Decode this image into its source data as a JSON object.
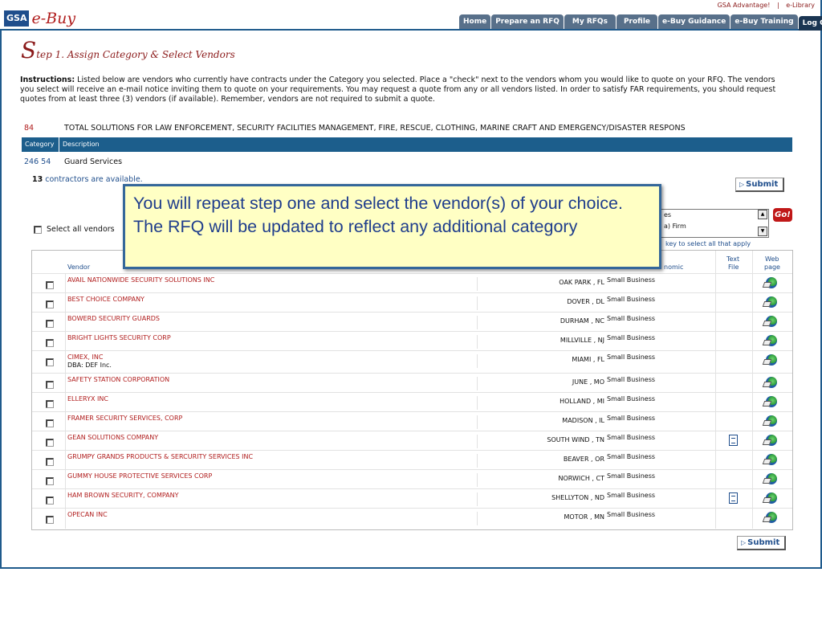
{
  "header": {
    "logo_gsa": "GSA",
    "logo_ebuy": "e-Buy",
    "top_links": [
      "GSA Advantage!",
      "|",
      "e-Library"
    ],
    "nav_tabs": [
      "Home",
      "Prepare an RFQ",
      "My RFQs",
      "Profile",
      "e-Buy Guidance",
      "e-Buy Training",
      "Log Off"
    ]
  },
  "page": {
    "title_initial": "S",
    "title_rest": "tep 1. Assign Category & Select Vendors",
    "instructions_label": "Instructions:",
    "instructions_text": "Listed below are vendors who currently have contracts under the Category you selected. Place a \"check\" next to the vendors whom you would like to quote on your RFQ. The vendors you select will receive an e-mail notice inviting them to quote on your requirements. You may request a quote from any or all vendors listed. In order to satisfy FAR requirements, you should request quotes from at least three (3) vendors (if available). Remember, vendors are not required to submit a quote."
  },
  "category": {
    "schedule_number": "84",
    "schedule_title": "TOTAL SOLUTIONS FOR LAW ENFORCEMENT, SECURITY FACILITIES MANAGEMENT, FIRE, RESCUE, CLOTHING, MARINE CRAFT AND EMERGENCY/DISASTER RESPONS",
    "col_category": "Category",
    "col_description": "Description",
    "code": "246 54",
    "description": "Guard Services"
  },
  "vendors_panel": {
    "count": "13",
    "count_suffix": "contractors are available.",
    "submit_label": "Submit",
    "select_all_label": "Select all vendors",
    "filter_options": [
      "es",
      "a) Firm"
    ],
    "go_label": "Go!",
    "hint": "key to select all that apply",
    "columns": {
      "vendor": "Vendor",
      "socioeconomic": "nomic",
      "text_file_1": "Text",
      "text_file_2": "File",
      "web_page_1": "Web",
      "web_page_2": "page"
    },
    "rows": [
      {
        "name": "AVAIL NATIONWIDE SECURITY SOLUTIONS INC",
        "dba": "",
        "location": "OAK PARK , FL",
        "type": "Small Business",
        "text_file": false
      },
      {
        "name": "BEST CHOICE COMPANY",
        "dba": "",
        "location": "DOVER , DL",
        "type": "Small Business",
        "text_file": false
      },
      {
        "name": "BOWERD SECURITY GUARDS",
        "dba": "",
        "location": "DURHAM , NC",
        "type": "Small Business",
        "text_file": false
      },
      {
        "name": "BRIGHT LIGHTS SECURITY CORP",
        "dba": "",
        "location": "MILLVILLE , NJ",
        "type": "Small Business",
        "text_file": false
      },
      {
        "name": "CIMEX, INC",
        "dba": "DBA: DEF Inc.",
        "location": "MIAMI , FL",
        "type": "Small Business",
        "text_file": false
      },
      {
        "name": "SAFETY STATION CORPORATION",
        "dba": "",
        "location": "JUNE , MO",
        "type": "Small Business",
        "text_file": false
      },
      {
        "name": "ELLERYX INC",
        "dba": "",
        "location": "HOLLAND , MI",
        "type": "Small Business",
        "text_file": false
      },
      {
        "name": "FRAMER SECURITY SERVICES, CORP",
        "dba": "",
        "location": "MADISON , IL",
        "type": "Small Business",
        "text_file": false
      },
      {
        "name": "GEAN SOLUTIONS COMPANY",
        "dba": "",
        "location": "SOUTH WIND , TN",
        "type": "Small Business",
        "text_file": true
      },
      {
        "name": "GRUMPY GRANDS PRODUCTS & SERCURITY SERVICES INC",
        "dba": "",
        "location": "BEAVER , OR",
        "type": "Small Business",
        "text_file": false
      },
      {
        "name": "GUMMY HOUSE PROTECTIVE SERVICES CORP",
        "dba": "",
        "location": "NORWICH , CT",
        "type": "Small Business",
        "text_file": false
      },
      {
        "name": "HAM BROWN SECURITY, COMPANY",
        "dba": "",
        "location": "SHELLYTON , ND",
        "type": "Small Business",
        "text_file": true
      },
      {
        "name": "OPECAN INC",
        "dba": "",
        "location": "MOTOR , MN",
        "type": "Small Business",
        "text_file": false
      }
    ]
  },
  "callout": {
    "text": "You will repeat step one and select the vendor(s) of your choice. The RFQ will be updated to reflect any additional category"
  },
  "colors": {
    "brand_blue": "#1f4e8c",
    "brand_red": "#b01c1c",
    "callout_bg": "#ffffc4"
  }
}
